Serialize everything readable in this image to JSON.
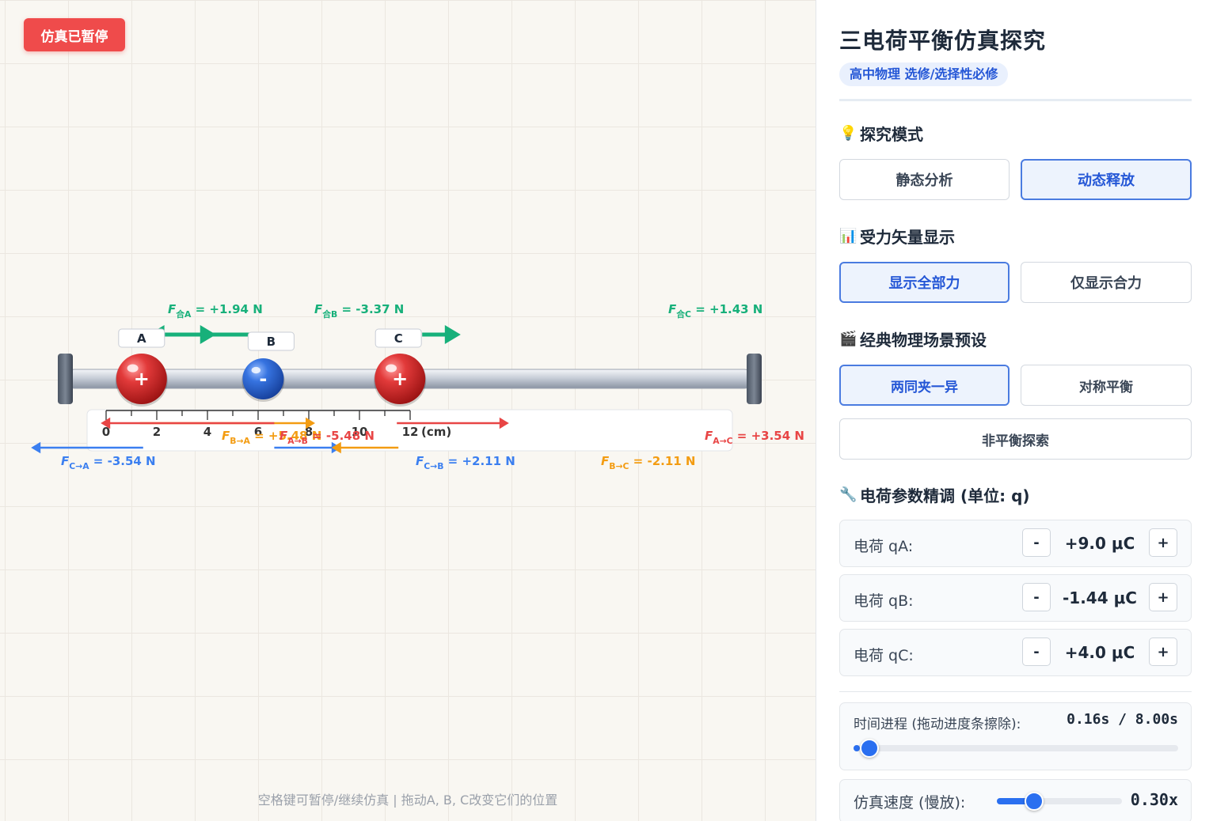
{
  "stage": {
    "pause_badge": "仿真已暂停",
    "hint": "空格键可暂停/继续仿真 | 拖动A, B, C改变它们的位置",
    "ruler": {
      "ticks": [
        "0",
        "2",
        "4",
        "6",
        "8",
        "10",
        "12"
      ],
      "unit": "(cm)",
      "range_cm": [
        0,
        12
      ]
    },
    "charges": [
      {
        "label": "A",
        "sign": "+",
        "position_cm": 1.4,
        "color": "#d62b2b"
      },
      {
        "label": "B",
        "sign": "-",
        "position_cm": 6.2,
        "color": "#2a62d6"
      },
      {
        "label": "C",
        "sign": "+",
        "position_cm": 11.6,
        "color": "#d62b2b"
      }
    ],
    "net_forces": [
      {
        "name": "F",
        "sub": "合A",
        "value_text": " = +1.94 N",
        "value": 1.94
      },
      {
        "name": "F",
        "sub": "合B",
        "value_text": " = -3.37 N",
        "value": -3.37
      },
      {
        "name": "F",
        "sub": "合C",
        "value_text": " = +1.43 N",
        "value": 1.43
      }
    ],
    "pair_forces": [
      {
        "name": "F",
        "sub": "B→A",
        "value_text": " = +5.48 N",
        "value": 5.48,
        "color": "#f39c12"
      },
      {
        "name": "F",
        "sub": "A→B",
        "value_text": " = -5.48 N",
        "value": -5.48,
        "color": "#e84545"
      },
      {
        "name": "F",
        "sub": "A→C",
        "value_text": " = +3.54 N",
        "value": 3.54,
        "color": "#e84545"
      },
      {
        "name": "F",
        "sub": "C→A",
        "value_text": " = -3.54 N",
        "value": -3.54,
        "color": "#3b7ff0"
      },
      {
        "name": "F",
        "sub": "C→B",
        "value_text": " = +2.11 N",
        "value": 2.11,
        "color": "#3b7ff0"
      },
      {
        "name": "F",
        "sub": "B→C",
        "value_text": " = -2.11 N",
        "value": -2.11,
        "color": "#f39c12"
      }
    ],
    "colors": {
      "net": "#17b07a",
      "positive": "#d62b2b",
      "negative": "#2a62d6"
    }
  },
  "panel": {
    "title": "三电荷平衡仿真探究",
    "subtitle": "高中物理 选修/选择性必修",
    "mode_section": {
      "icon": "lightbulb-icon",
      "icon_glyph": "💡",
      "title": "探究模式",
      "options": [
        "静态分析",
        "动态释放"
      ],
      "selected": "动态释放"
    },
    "vector_section": {
      "icon": "bar-chart-icon",
      "icon_glyph": "📊",
      "title": "受力矢量显示",
      "options": [
        "显示全部力",
        "仅显示合力"
      ],
      "selected": "显示全部力"
    },
    "scene_section": {
      "icon": "clapperboard-icon",
      "icon_glyph": "🎬",
      "title": "经典物理场景预设",
      "options": [
        "两同夹一异",
        "对称平衡",
        "非平衡探索"
      ],
      "selected": "两同夹一异"
    },
    "params_section": {
      "icon": "wrench-icon",
      "icon_glyph": "🔧",
      "title": "电荷参数精调 (单位: q)",
      "rows": [
        {
          "label": "电荷 qA:",
          "value": "+9.0 μC"
        },
        {
          "label": "电荷 qB:",
          "value": "-1.44 μC"
        },
        {
          "label": "电荷 qC:",
          "value": "+4.0 μC"
        }
      ],
      "minus": "-",
      "plus": "+"
    },
    "time": {
      "label": "时间进程 (拖动进度条擦除):",
      "value_text": "0.16s / 8.00s",
      "current": 0.16,
      "total": 8.0
    },
    "speed": {
      "label": "仿真速度 (慢放):",
      "value_text": "0.30x",
      "fraction": 0.3
    }
  }
}
